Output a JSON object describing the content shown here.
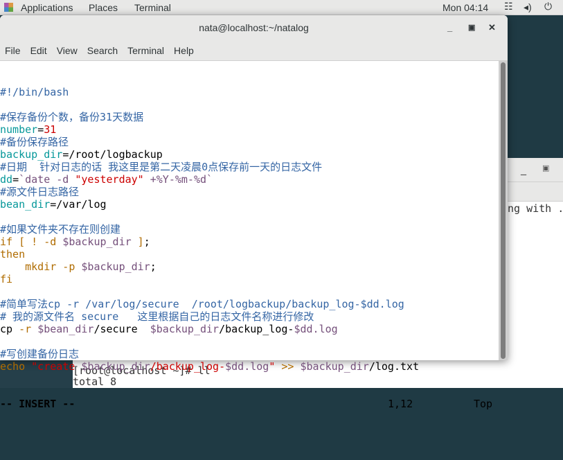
{
  "topbar": {
    "applications": "Applications",
    "places": "Places",
    "terminal": "Terminal",
    "clock": "Mon 04:14"
  },
  "bg_window": {
    "partial_text": "ng with .",
    "prompt": "[root@localhost ~]# ll",
    "output": "total 8"
  },
  "window": {
    "title": "nata@localhost:~/natalog",
    "menu": [
      "File",
      "Edit",
      "View",
      "Search",
      "Terminal",
      "Help"
    ]
  },
  "colors": {
    "comment": "#3465a4",
    "variable": "#06989a",
    "number_string": "#cc0000",
    "expansion": "#75507b",
    "keyword": "#b06c00"
  },
  "editor": {
    "lines": [
      [
        [
          "c",
          "#!/bin/bash"
        ]
      ],
      [],
      [
        [
          "c",
          "#保存备份个数，备份31天数据"
        ]
      ],
      [
        [
          "v",
          "number"
        ],
        [
          "p",
          "="
        ],
        [
          "n",
          "31"
        ]
      ],
      [
        [
          "c",
          "#备份保存路径"
        ]
      ],
      [
        [
          "v",
          "backup_dir"
        ],
        [
          "p",
          "=/root/logbackup"
        ]
      ],
      [
        [
          "c",
          "#日期  针对日志的话 我这里是第二天凌晨0点保存前一天的日志文件"
        ]
      ],
      [
        [
          "v",
          "dd"
        ],
        [
          "p",
          "="
        ],
        [
          "s",
          "`date -d "
        ],
        [
          "n",
          "\"yesterday\""
        ],
        [
          "s",
          " +%Y-%m-%d`"
        ]
      ],
      [
        [
          "c",
          "#源文件日志路径"
        ]
      ],
      [
        [
          "v",
          "bean_dir"
        ],
        [
          "p",
          "=/var/log"
        ]
      ],
      [],
      [
        [
          "c",
          "#如果文件夹不存在则创建"
        ]
      ],
      [
        [
          "k",
          "if [ ! -d "
        ],
        [
          "s",
          "$backup_dir"
        ],
        [
          "k",
          " ]"
        ],
        [
          "p",
          ";"
        ]
      ],
      [
        [
          "k",
          "then"
        ]
      ],
      [
        [
          "k",
          "    mkdir -p "
        ],
        [
          "s",
          "$backup_dir"
        ],
        [
          "p",
          ";"
        ]
      ],
      [
        [
          "k",
          "fi"
        ]
      ],
      [],
      [
        [
          "c",
          "#简单写法cp -r /var/log/secure  /root/logbackup/backup_log-$dd.log"
        ]
      ],
      [
        [
          "c",
          "# 我的源文件名 secure   这里根据自己的日志文件名称进行修改"
        ]
      ],
      [
        [
          "p",
          "cp "
        ],
        [
          "k",
          "-r "
        ],
        [
          "s",
          "$bean_dir"
        ],
        [
          "p",
          "/secure  "
        ],
        [
          "s",
          "$backup_dir"
        ],
        [
          "p",
          "/backup_log-"
        ],
        [
          "s",
          "$dd.log"
        ]
      ],
      [],
      [
        [
          "c",
          "#写创建备份日志"
        ]
      ],
      [
        [
          "k",
          "echo "
        ],
        [
          "n",
          "\"create "
        ],
        [
          "s",
          "$backup_dir"
        ],
        [
          "n",
          "/backup_log-"
        ],
        [
          "s",
          "$dd.log"
        ],
        [
          "n",
          "\""
        ],
        [
          "k",
          " >> "
        ],
        [
          "s",
          "$backup_dir"
        ],
        [
          "p",
          "/log.txt"
        ]
      ]
    ],
    "status": {
      "mode": "-- INSERT --",
      "position": "1,12",
      "scroll": "Top"
    }
  }
}
